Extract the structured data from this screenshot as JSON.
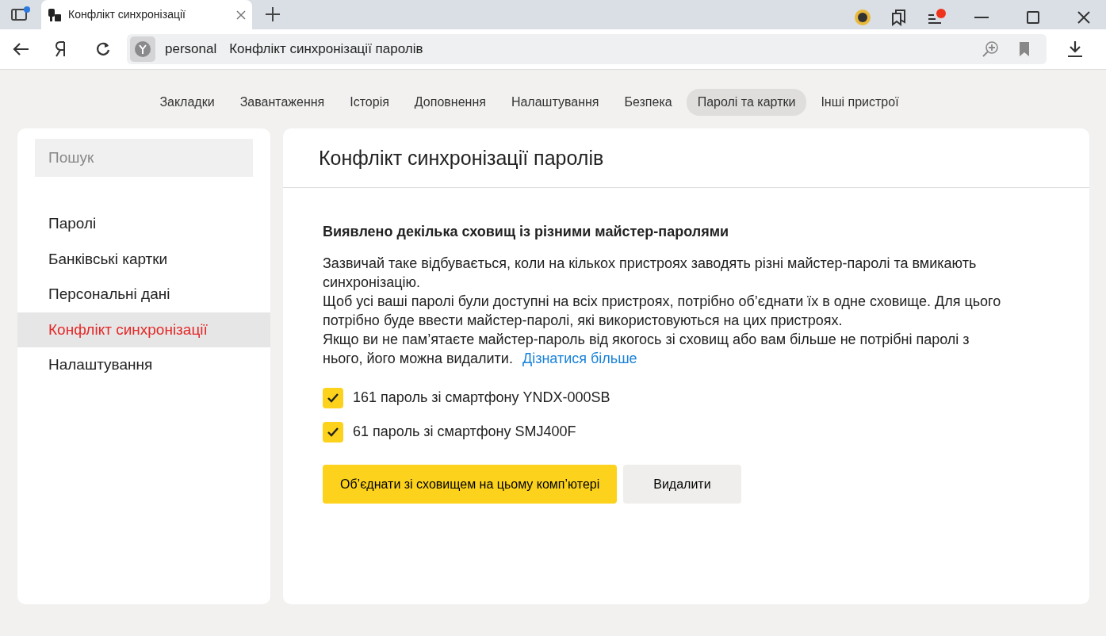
{
  "browser": {
    "tab_title": "Конфлікт синхронізації",
    "address_host": "personal",
    "address_title": "Конфлікт синхронізації паролів"
  },
  "nav_tabs": [
    {
      "label": "Закладки",
      "selected": false
    },
    {
      "label": "Завантаження",
      "selected": false
    },
    {
      "label": "Історія",
      "selected": false
    },
    {
      "label": "Доповнення",
      "selected": false
    },
    {
      "label": "Налаштування",
      "selected": false
    },
    {
      "label": "Безпека",
      "selected": false
    },
    {
      "label": "Паролі та картки",
      "selected": true
    },
    {
      "label": "Інші пристрої",
      "selected": false
    }
  ],
  "sidebar": {
    "search": {
      "placeholder": "Пошук"
    },
    "items": [
      {
        "label": "Паролі",
        "selected": false
      },
      {
        "label": "Банківські картки",
        "selected": false
      },
      {
        "label": "Персональні дані",
        "selected": false
      },
      {
        "label": "Конфлікт синхронізації",
        "selected": true
      },
      {
        "label": "Налаштування",
        "selected": false
      }
    ]
  },
  "main": {
    "title": "Конфлікт синхронізації паролів",
    "heading": "Виявлено декілька сховищ із різними майстер-паролями",
    "paragraphs": [
      "Зазвичай таке відбувається, коли на кількох пристроях заводять різні майстер-паролі та вмикають синхронізацію.",
      "Щоб усі ваші паролі були доступні на всіх пристроях, потрібно об’єднати їх в одне сховище. Для цього потрібно буде ввести майстер-паролі, які використовуються на цих пристроях.",
      "Якщо ви не пам’ятаєте майстер-пароль від якогось зі сховищ або вам більше не потрібні паролі з нього, його можна видалити."
    ],
    "link": "Дізнатися більше",
    "stores": [
      {
        "label": "161 пароль зі смартфону YNDX-000SB",
        "checked": true
      },
      {
        "label": "61 пароль зі смартфону SMJ400F",
        "checked": true
      }
    ],
    "buttons": [
      {
        "label": "Об’єднати зі сховищем на цьому комп’ютері",
        "kind": "primary"
      },
      {
        "label": "Видалити",
        "kind": "secondary"
      }
    ]
  }
}
